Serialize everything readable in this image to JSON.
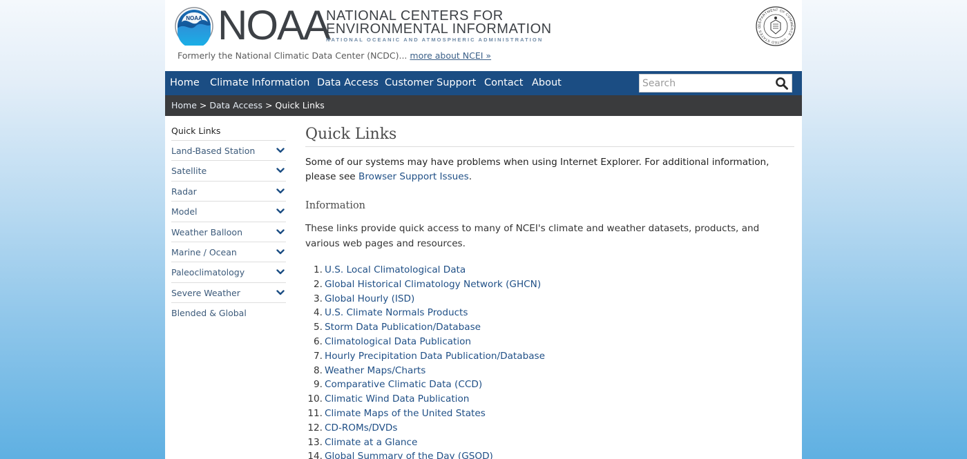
{
  "header": {
    "noaa_logo_text": "NOAA",
    "noaa_wordmark": "NOAA",
    "ncei_line1": "NATIONAL CENTERS FOR",
    "ncei_line2": "ENVIRONMENTAL INFORMATION",
    "ncei_line3": "NATIONAL OCEANIC AND ATMOSPHERIC ADMINISTRATION",
    "seal_text": "DEPARTMENT OF COMMERCE · UNITED STATES OF AMERICA",
    "formerly_text": "Formerly the National Climatic Data Center (NCDC)...",
    "formerly_link": "more about NCEI »"
  },
  "nav": {
    "items": [
      "Home",
      "Climate Information",
      "Data Access",
      "Customer Support",
      "Contact",
      "About"
    ],
    "search_placeholder": "Search"
  },
  "breadcrumb": {
    "home": "Home",
    "sep1": " > ",
    "data_access": "Data Access",
    "sep2": " > ",
    "current": "Quick Links"
  },
  "sidebar": {
    "title": "Quick Links",
    "items": [
      {
        "label": "Land-Based Station",
        "expandable": true
      },
      {
        "label": "Satellite",
        "expandable": true
      },
      {
        "label": "Radar",
        "expandable": true
      },
      {
        "label": "Model",
        "expandable": true
      },
      {
        "label": "Weather Balloon",
        "expandable": true
      },
      {
        "label": "Marine / Ocean",
        "expandable": true
      },
      {
        "label": "Paleoclimatology",
        "expandable": true
      },
      {
        "label": "Severe Weather",
        "expandable": true
      },
      {
        "label": "Blended & Global",
        "expandable": false
      }
    ]
  },
  "main": {
    "title": "Quick Links",
    "notice_text": "Some of our systems may have problems when using Internet Explorer. For additional information, please see",
    "notice_link": "Browser Support Issues",
    "notice_end": ".",
    "subheading": "Information",
    "intro": "These links provide quick access to many of NCEI's climate and weather datasets, products, and various web pages and resources.",
    "links": [
      "U.S. Local Climatological Data",
      "Global Historical Climatology Network (GHCN)",
      "Global Hourly (ISD)",
      "U.S. Climate Normals Products",
      "Storm Data Publication/Database",
      "Climatological Data Publication",
      "Hourly Precipitation Data Publication/Database",
      "Weather Maps/Charts",
      "Comparative Climatic Data (CCD)",
      "Climatic Wind Data Publication",
      "Climate Maps of the United States",
      "CD-ROMs/DVDs",
      "Climate at a Glance",
      "Global Summary of the Day (GSOD)"
    ]
  },
  "colors": {
    "nav_bg": "#1b4d83",
    "breadcrumb_bg": "#3a3b3d",
    "link": "#1f4f86",
    "sidebar_link": "#3c5a7a"
  }
}
